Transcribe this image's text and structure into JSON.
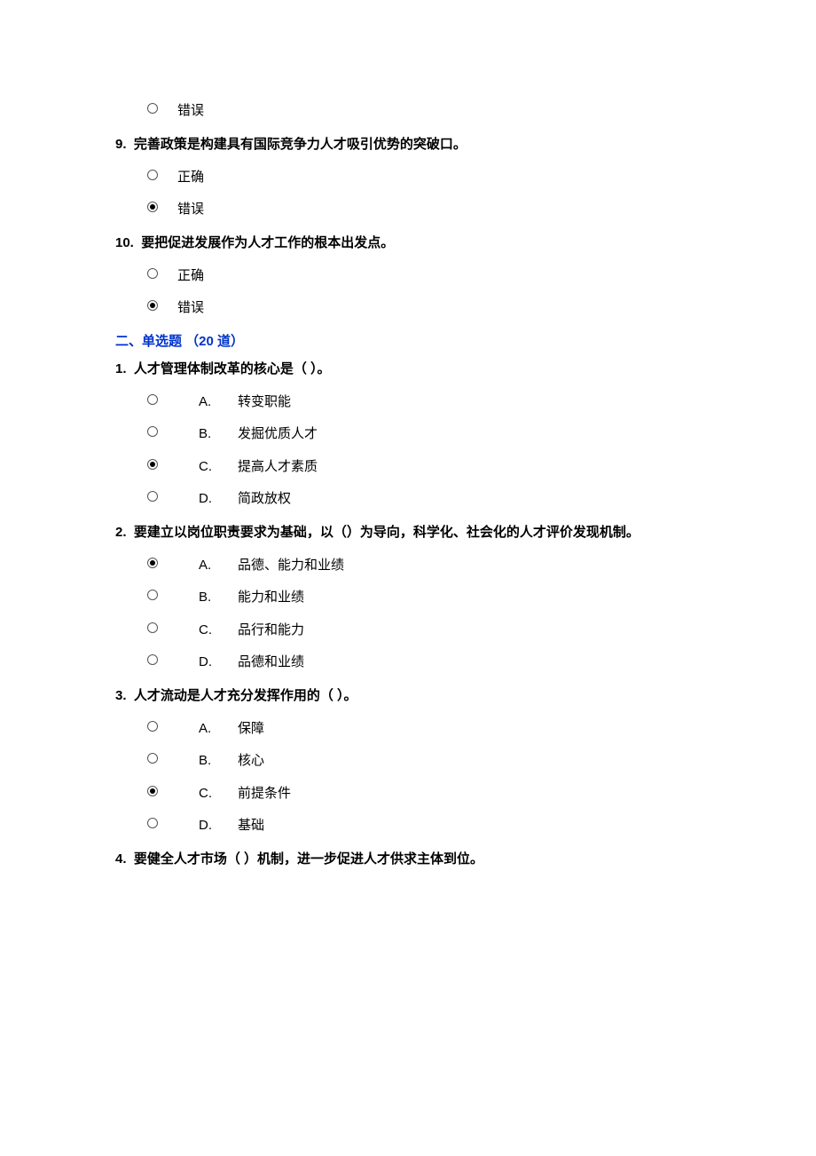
{
  "q8_tail_opt": "错误",
  "q9": {
    "num": "9.",
    "text": "完善政策是构建具有国际竞争力人才吸引优势的突破口。",
    "opts": [
      "正确",
      "错误"
    ],
    "selected": 1
  },
  "q10": {
    "num": "10.",
    "text": "要把促进发展作为人才工作的根本出发点。",
    "opts": [
      "正确",
      "错误"
    ],
    "selected": 1
  },
  "section2": "二、单选题 （20 道）",
  "mc1": {
    "num": "1.",
    "text": "人才管理体制改革的核心是（ ）。",
    "letters": [
      "A.",
      "B.",
      "C.",
      "D."
    ],
    "opts": [
      "转变职能",
      "发掘优质人才",
      "提高人才素质",
      "简政放权"
    ],
    "selected": 2
  },
  "mc2": {
    "num": "2.",
    "text": "要建立以岗位职责要求为基础，以（）为导向，科学化、社会化的人才评价发现机制。",
    "letters": [
      "A.",
      "B.",
      "C.",
      "D."
    ],
    "opts": [
      "品德、能力和业绩",
      "能力和业绩",
      "品行和能力",
      "品德和业绩"
    ],
    "selected": 0
  },
  "mc3": {
    "num": "3.",
    "text": "人才流动是人才充分发挥作用的（ ）。",
    "letters": [
      "A.",
      "B.",
      "C.",
      "D."
    ],
    "opts": [
      "保障",
      "核心",
      "前提条件",
      "基础"
    ],
    "selected": 2
  },
  "mc4": {
    "num": "4.",
    "text": "要健全人才市场（ ）机制，进一步促进人才供求主体到位。"
  }
}
